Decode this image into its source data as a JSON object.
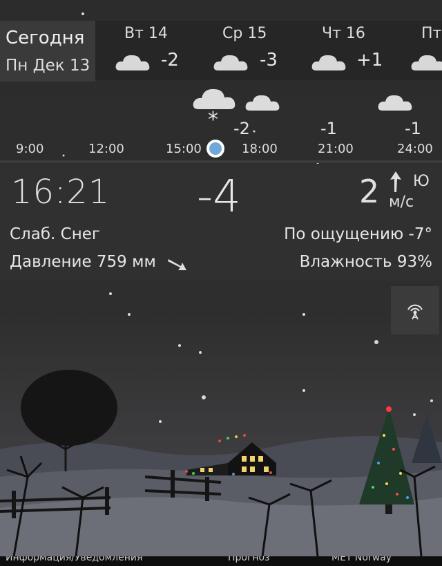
{
  "today": {
    "label": "Сегодня",
    "date": "Пн Дек 13"
  },
  "days": [
    {
      "name": "Вт 14",
      "temp": "-2",
      "icon": "cloud-icon"
    },
    {
      "name": "Ср 15",
      "temp": "-3",
      "icon": "cloud-icon"
    },
    {
      "name": "Чт 16",
      "temp": "+1",
      "icon": "cloud-icon"
    },
    {
      "name": "Пт",
      "temp": "",
      "icon": "cloud-icon"
    }
  ],
  "hourly": {
    "times": [
      "9:00",
      "12:00",
      "15:00",
      "18:00",
      "21:00",
      "24:00"
    ],
    "temps": [
      "-2",
      "-1",
      "-1"
    ],
    "snow_marker": "*"
  },
  "current": {
    "time": "16:21",
    "temp": "-4",
    "wind_speed": "2",
    "wind_direction": "Ю",
    "wind_unit": "м/с",
    "condition": "Слаб. Снег",
    "feels_like": "По ощущению -7°",
    "pressure": "Давление 759 мм",
    "humidity": "Влажность 93%"
  },
  "radar_icon": "radar-icon",
  "bottom_bar": [
    "Информация/Уведомления",
    "Прогноз",
    "МЕТ Norway"
  ],
  "colors": {
    "accent": "#6fa8d8",
    "panel": "#303030",
    "strip": "#262626"
  }
}
